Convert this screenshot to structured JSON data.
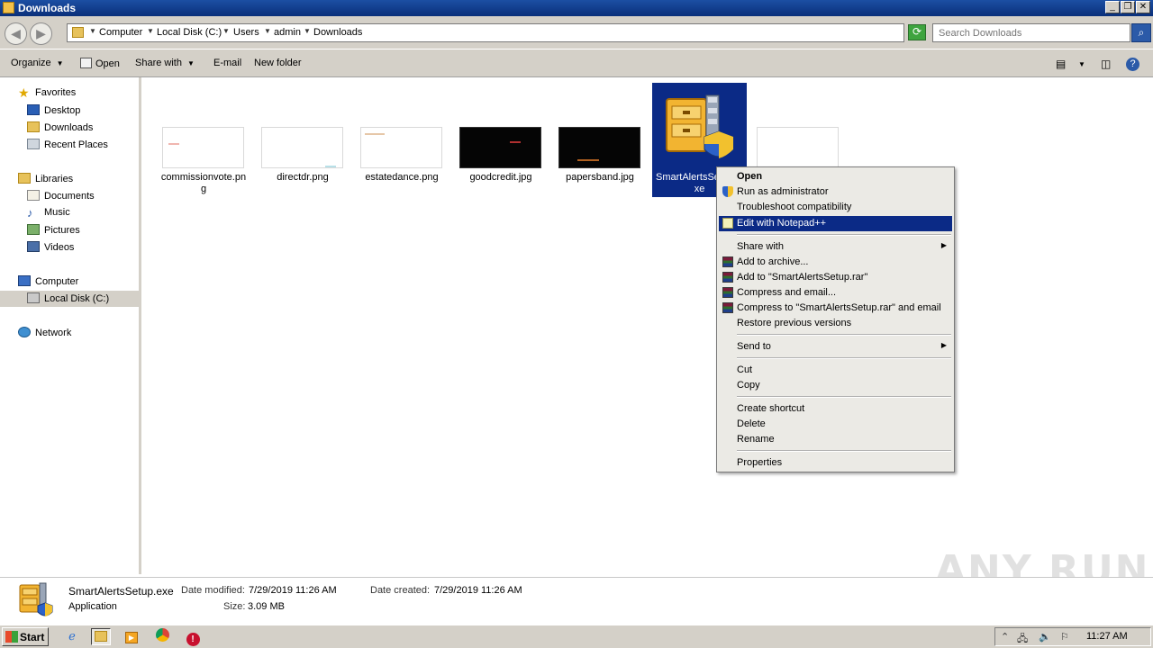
{
  "window": {
    "title": "Downloads"
  },
  "address": {
    "crumbs": [
      "Computer",
      "Local Disk (C:)",
      "Users",
      "admin",
      "Downloads"
    ],
    "search_placeholder": "Search Downloads"
  },
  "toolbar": {
    "organize": "Organize",
    "open": "Open",
    "share_with": "Share with",
    "email": "E-mail",
    "new_folder": "New folder"
  },
  "nav": {
    "favorites": "Favorites",
    "desktop": "Desktop",
    "downloads": "Downloads",
    "recent_places": "Recent Places",
    "libraries": "Libraries",
    "documents": "Documents",
    "music": "Music",
    "pictures": "Pictures",
    "videos": "Videos",
    "computer": "Computer",
    "local_disk": "Local Disk (C:)",
    "network": "Network"
  },
  "files": [
    {
      "name_line1": "commissionvote.pn",
      "name_line2": "g",
      "theme": "light"
    },
    {
      "name_line1": "directdr.png",
      "name_line2": "",
      "theme": "light"
    },
    {
      "name_line1": "estatedance.png",
      "name_line2": "",
      "theme": "light"
    },
    {
      "name_line1": "goodcredit.jpg",
      "name_line2": "",
      "theme": "dark"
    },
    {
      "name_line1": "papersband.jpg",
      "name_line2": "",
      "theme": "dark"
    },
    {
      "name_line1": "SmartAlertsSe",
      "name_line2": "xe",
      "theme": "selected"
    }
  ],
  "context_menu": {
    "open": "Open",
    "run_as_admin": "Run as administrator",
    "troubleshoot": "Troubleshoot compatibility",
    "edit_notepad": "Edit with Notepad++",
    "share_with": "Share with",
    "add_archive": "Add to archive...",
    "add_rar": "Add to \"SmartAlertsSetup.rar\"",
    "compress_email": "Compress and email...",
    "compress_rar_email": "Compress to \"SmartAlertsSetup.rar\" and email",
    "restore_versions": "Restore previous versions",
    "send_to": "Send to",
    "cut": "Cut",
    "copy": "Copy",
    "create_shortcut": "Create shortcut",
    "delete": "Delete",
    "rename": "Rename",
    "properties": "Properties"
  },
  "details": {
    "filename": "SmartAlertsSetup.exe",
    "type": "Application",
    "date_modified_label": "Date modified:",
    "date_modified": "7/29/2019 11:26 AM",
    "date_created_label": "Date created:",
    "date_created": "7/29/2019 11:26 AM",
    "size_label": "Size:",
    "size": "3.09 MB"
  },
  "taskbar": {
    "start": "Start",
    "clock": "11:27 AM"
  },
  "watermark": "ANY RUN",
  "colors": {
    "selection": "#0b2a86",
    "chrome": "#d4d0c8"
  }
}
